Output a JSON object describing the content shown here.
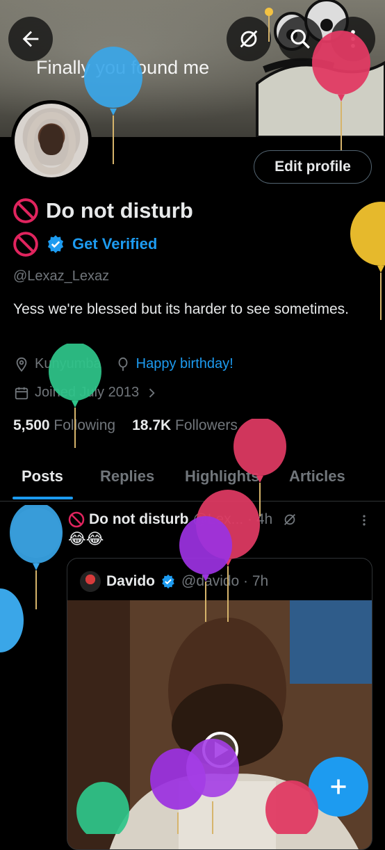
{
  "header": {
    "banner_caption": "Finally you found me",
    "back_icon": "back-arrow-icon",
    "grok_icon": "grok-icon",
    "search_icon": "search-icon",
    "more_icon": "more-vertical-icon"
  },
  "profile": {
    "edit_profile_label": "Edit profile",
    "display_name": "Do not disturb",
    "get_verified_label": "Get Verified",
    "handle": "@Lexaz_Lexaz",
    "bio": "Yess we're blessed but its harder to see sometimes.",
    "location": "Kunyumba",
    "website": "Happy birthday!",
    "joined": "Joined July 2013",
    "following_count": "5,500",
    "following_label": "Following",
    "followers_count": "18.7K",
    "followers_label": "Followers"
  },
  "tabs": [
    {
      "label": "Posts"
    },
    {
      "label": "Replies"
    },
    {
      "label": "Highlights"
    },
    {
      "label": "Articles"
    }
  ],
  "post": {
    "author": "Do not disturb",
    "meta": "@Lex... · 4h",
    "text": "😂😂",
    "quote": {
      "author": "Davido",
      "meta": "@davido · 7h"
    }
  },
  "fab": {
    "icon": "plus-icon"
  },
  "colors": {
    "accent": "#1d9bf0",
    "background": "#000000",
    "text_primary": "#e7e9ea",
    "text_secondary": "#71767b",
    "ban_red": "#e0245e"
  }
}
